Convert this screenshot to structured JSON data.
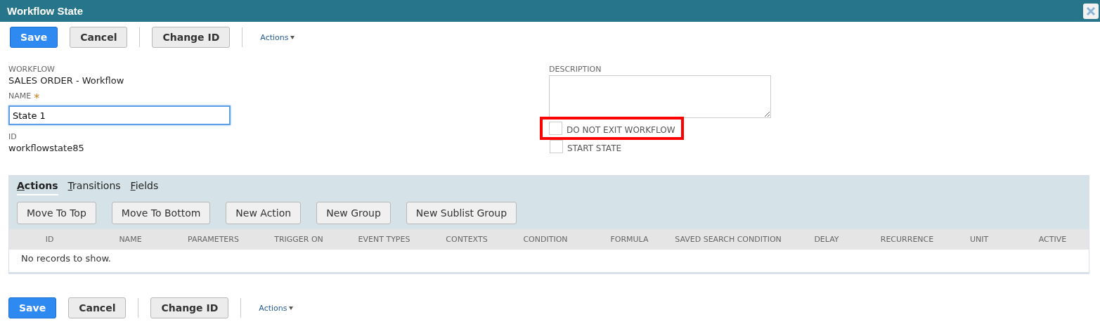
{
  "window": {
    "title": "Workflow State"
  },
  "toolbar_top": {
    "buttons": [
      {
        "label": "Save",
        "kind": "primary"
      },
      {
        "label": "Cancel",
        "kind": "secondary"
      },
      {
        "label": "Change ID",
        "kind": "secondary"
      }
    ],
    "menu": "Actions"
  },
  "fields": {
    "workflow": {
      "label": "WORKFLOW",
      "value": "SALES ORDER - Workflow"
    },
    "name": {
      "label": "NAME",
      "required_mark": "*",
      "value": "State 1"
    },
    "id": {
      "label": "ID",
      "value": "workflowstate85"
    },
    "description": {
      "label": "DESCRIPTION"
    },
    "checkboxes": [
      {
        "label": "DO NOT EXIT WORKFLOW",
        "checked": false,
        "highlighted": true
      },
      {
        "label": "START STATE",
        "checked": false,
        "highlighted": false
      }
    ]
  },
  "sublist": {
    "tabs": [
      {
        "label": "Actions",
        "selected": true
      },
      {
        "label": "Transitions",
        "selected": false
      },
      {
        "label": "Fields",
        "selected": false
      }
    ],
    "buttons": [
      "Move To Top",
      "Move To Bottom",
      "New Action",
      "New Group",
      "New Sublist Group"
    ],
    "columns": [
      "ID",
      "NAME",
      "PARAMETERS",
      "TRIGGER ON",
      "EVENT TYPES",
      "CONTEXTS",
      "CONDITION",
      "FORMULA",
      "SAVED SEARCH CONDITION",
      "DELAY",
      "RECURRENCE",
      "UNIT",
      "ACTIVE"
    ],
    "empty_message": "No records to show."
  },
  "toolbar_bottom": {
    "buttons": [
      {
        "label": "Save",
        "kind": "primary"
      },
      {
        "label": "Cancel",
        "kind": "secondary"
      },
      {
        "label": "Change ID",
        "kind": "secondary"
      }
    ],
    "menu": "Actions"
  }
}
